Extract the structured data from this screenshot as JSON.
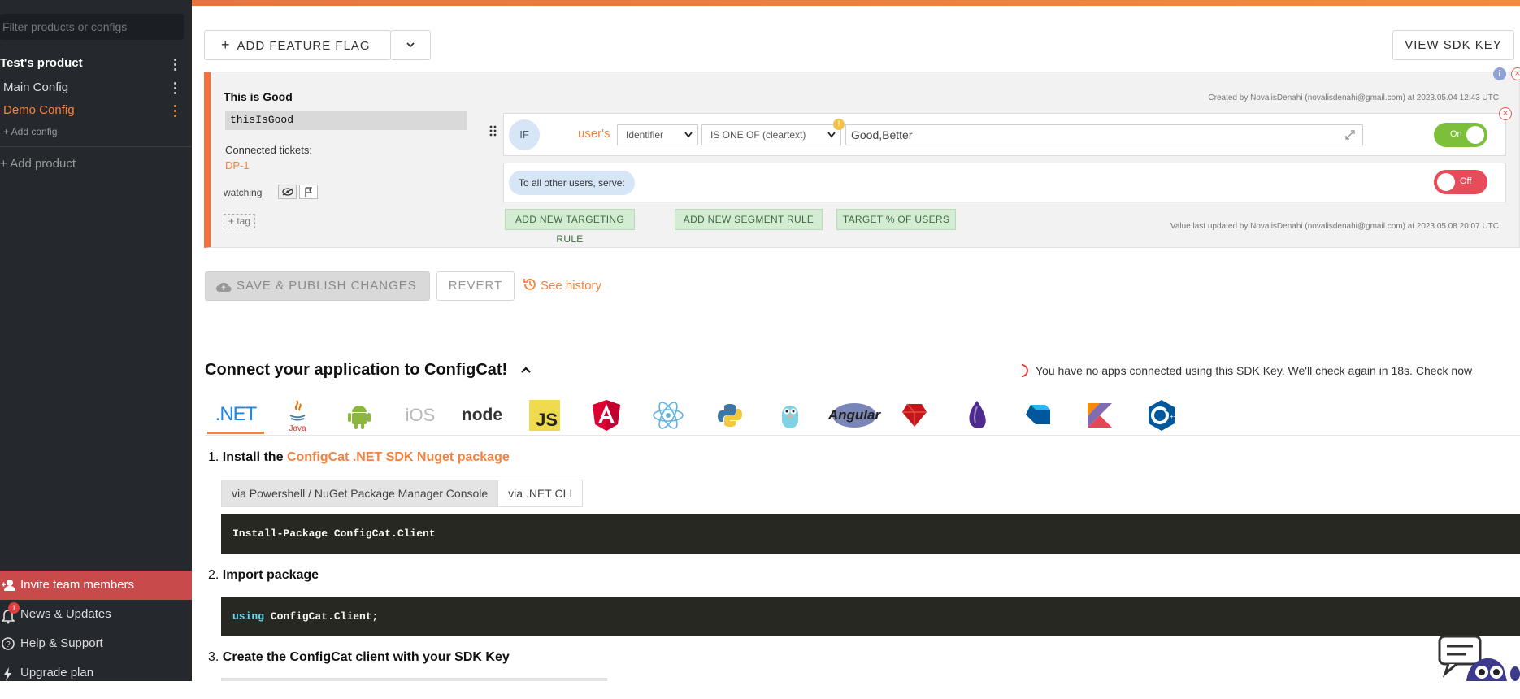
{
  "sidebar": {
    "filter_placeholder": "Filter products or configs",
    "product_name": "Test's product",
    "configs": [
      {
        "label": "Main Config",
        "active": false
      },
      {
        "label": "Demo Config",
        "active": true
      }
    ],
    "add_config": "+ Add config",
    "add_product": "+ Add product",
    "bottom": {
      "invite": "Invite team members",
      "news": "News & Updates",
      "news_badge": "1",
      "help": "Help & Support",
      "upgrade": "Upgrade plan"
    }
  },
  "toolbar": {
    "add_feature_flag": "ADD FEATURE FLAG",
    "view_sdk_key": "VIEW SDK KEY"
  },
  "flag": {
    "name": "This is Good",
    "key": "thisIsGood",
    "connected_tickets_label": "Connected tickets:",
    "ticket": "DP-1",
    "watching_label": "watching",
    "add_tag": "+ tag",
    "created_by": "Created by NovalisDenahi (novalisdenahi@gmail.com) at 2023.05.04 12:43 UTC",
    "rule": {
      "if_label": "IF",
      "users_label": "user's",
      "attribute": "Identifier",
      "comparator": "IS ONE OF (cleartext)",
      "value": "Good,Better",
      "toggle": "On"
    },
    "default_rule": {
      "label": "To all other users, serve:",
      "toggle": "Off"
    },
    "buttons": {
      "targeting": "ADD NEW TARGETING RULE",
      "segment": "ADD NEW SEGMENT RULE",
      "percentage": "TARGET % OF USERS"
    },
    "value_updated": "Value last updated by NovalisDenahi (novalisdenahi@gmail.com) at 2023.05.08 20:07 UTC"
  },
  "actions": {
    "save": "SAVE & PUBLISH CHANGES",
    "revert": "REVERT",
    "history": "See history"
  },
  "connect": {
    "title": "Connect your application to ConfigCat!",
    "status_pre": "You have no apps connected using",
    "status_link": "this",
    "status_post": "SDK Key. We'll check again in 18s.",
    "check_now": "Check now",
    "sdks": [
      ".NET",
      "Java",
      "Android",
      "iOS",
      "node",
      "JS",
      "Angular",
      "React",
      "Python",
      "Go",
      "php",
      "Ruby",
      "Elixir",
      "Dart",
      "Kotlin",
      "C++"
    ],
    "step1_prefix": "Install the",
    "step1_link": "ConfigCat .NET SDK Nuget package",
    "tab_powershell": "via Powershell / NuGet Package Manager Console",
    "tab_cli": "via .NET CLI",
    "install_code": "Install-Package ConfigCat.Client",
    "step2": "Import package",
    "import_keyword": "using",
    "import_code": "ConfigCat.Client;",
    "step3": "Create the ConfigCat client with your SDK Key"
  },
  "colors": {
    "accent": "#f4713d",
    "sidebar": "#25292e",
    "invite": "#c94a4a",
    "toggle_on": "#7bbf3a",
    "toggle_off": "#e74c5b"
  }
}
